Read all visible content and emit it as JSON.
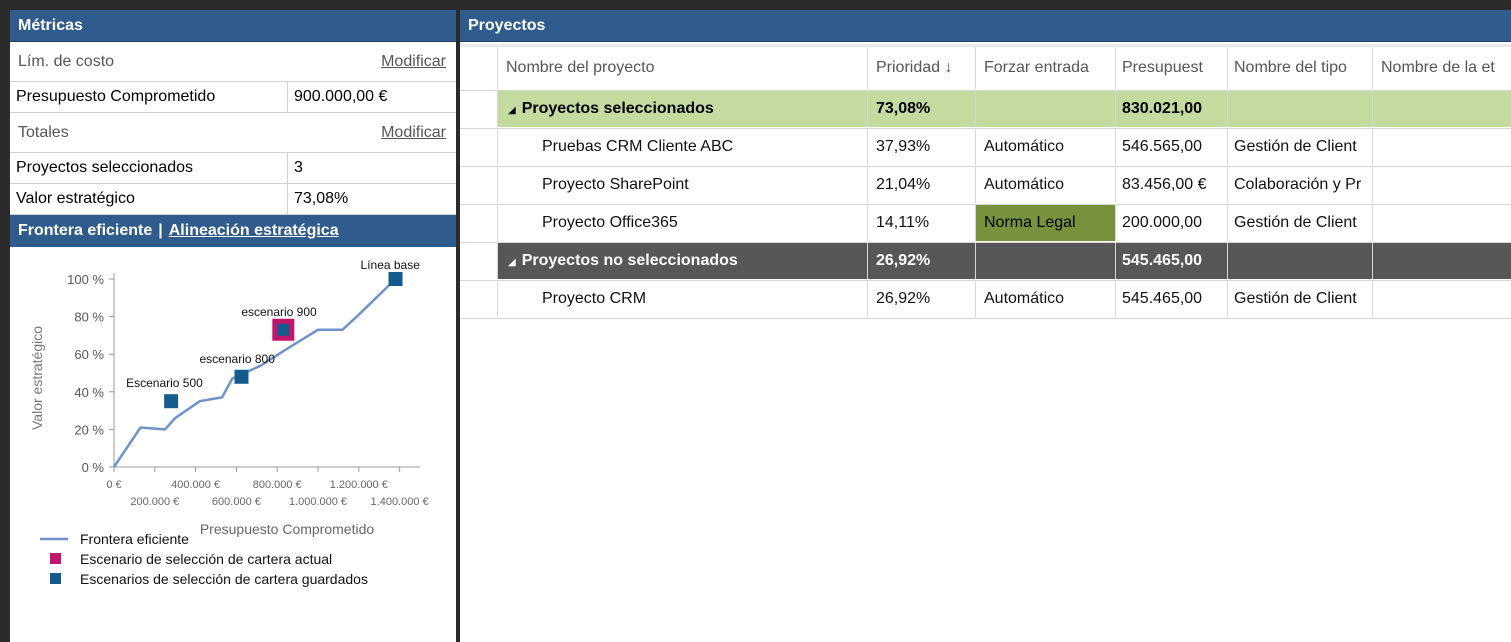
{
  "metrics": {
    "title": "Métricas",
    "cost_limit_label": "Lím. de costo",
    "cost_limit_modify": "Modificar",
    "committed_budget_label": "Presupuesto Comprometido",
    "committed_budget_value": "900.000,00 €",
    "totals_label": "Totales",
    "totals_modify": "Modificar",
    "selected_projects_label": "Proyectos seleccionados",
    "selected_projects_value": "3",
    "strategic_value_label": "Valor estratégico",
    "strategic_value_value": "73,08%"
  },
  "chart_header": {
    "tab_active": "Frontera eficiente",
    "separator": "|",
    "tab_link": "Alineación estratégica"
  },
  "chart_data": {
    "type": "line",
    "xlabel": "Presupuesto Comprometido",
    "ylabel": "Valor estratégico",
    "xlim": [
      0,
      1500000
    ],
    "ylim": [
      0,
      100
    ],
    "x_ticks_top": [
      "0 €",
      "400.000 €",
      "800.000 €",
      "1.200.000 €"
    ],
    "x_ticks_bottom": [
      "200.000 €",
      "600.000 €",
      "1.000.000 €",
      "1.400.000 €"
    ],
    "y_ticks": [
      "0 %",
      "20 %",
      "40 %",
      "60 %",
      "80 %",
      "100 %"
    ],
    "series": [
      {
        "name": "Frontera eficiente",
        "color": "#6f93c8",
        "x": [
          0,
          130000,
          250000,
          300000,
          420000,
          530000,
          580000,
          720000,
          850000,
          1000000,
          1120000,
          1200000,
          1380000
        ],
        "y": [
          0,
          21,
          20,
          26,
          35,
          37,
          47,
          54,
          63,
          73,
          73,
          81,
          100
        ]
      }
    ],
    "points": [
      {
        "label": "Escenario 500",
        "x": 280000,
        "y": 35,
        "kind": "saved"
      },
      {
        "label": "escenario 800",
        "x": 625000,
        "y": 48,
        "kind": "saved"
      },
      {
        "label": "escenario 900",
        "x": 830000,
        "y": 73,
        "kind": "saved"
      },
      {
        "label": "",
        "x": 830000,
        "y": 73,
        "kind": "current"
      },
      {
        "label": "Línea base",
        "x": 1380000,
        "y": 100,
        "kind": "saved"
      }
    ],
    "legend": [
      {
        "label": "Frontera eficiente",
        "kind": "line",
        "color": "#6f93c8"
      },
      {
        "label": "Escenario de selección de cartera actual",
        "kind": "square",
        "color": "#c2166c"
      },
      {
        "label": "Escenarios de selección de cartera guardados",
        "kind": "square",
        "color": "#145b8e"
      }
    ],
    "legend_position": "bottom-left"
  },
  "projects": {
    "title": "Proyectos",
    "columns": [
      "Nombre del proyecto",
      "Prioridad ↓",
      "Forzar entrada",
      "Presupuest",
      "Nombre del tipo",
      "Nombre de la et"
    ],
    "groups": [
      {
        "name": "Proyectos seleccionados",
        "priority": "73,08%",
        "force": "",
        "budget": "830.021,00",
        "rows": [
          {
            "name": "Pruebas CRM Cliente ABC",
            "priority": "37,93%",
            "force": "Automático",
            "budget": "546.565,00",
            "type": "Gestión de Client",
            "stage": ""
          },
          {
            "name": "Proyecto SharePoint",
            "priority": "21,04%",
            "force": "Automático",
            "budget": "83.456,00 €",
            "type": "Colaboración y Pr",
            "stage": ""
          },
          {
            "name": "Proyecto Office365",
            "priority": "14,11%",
            "force": "Norma Legal",
            "budget": "200.000,00",
            "type": "Gestión de Client",
            "stage": ""
          }
        ]
      },
      {
        "name": "Proyectos no seleccionados",
        "priority": "26,92%",
        "force": "",
        "budget": "545.465,00",
        "rows": [
          {
            "name": "Proyecto CRM",
            "priority": "26,92%",
            "force": "Automático",
            "budget": "545.465,00",
            "type": "Gestión de Client",
            "stage": ""
          }
        ]
      }
    ]
  }
}
